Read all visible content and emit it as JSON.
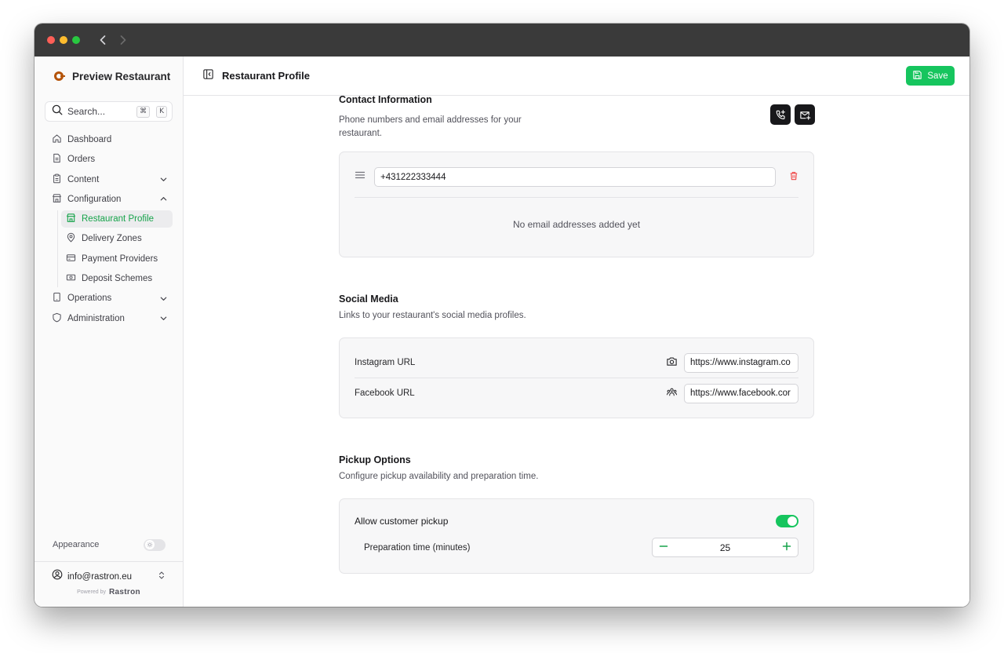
{
  "window": {
    "traffic_lights": [
      "close",
      "minimize",
      "zoom"
    ],
    "nav": {
      "back_icon": "chevron-left-icon",
      "forward_icon": "chevron-right-icon"
    }
  },
  "sidebar": {
    "brand": "Preview Restaurant",
    "search": {
      "placeholder": "Search...",
      "shortcut_mod": "⌘",
      "shortcut_key": "K"
    },
    "items": [
      {
        "label": "Dashboard",
        "icon": "home-icon"
      },
      {
        "label": "Orders",
        "icon": "document-icon"
      },
      {
        "label": "Content",
        "icon": "clipboard-icon",
        "expandable": true,
        "expanded": false
      },
      {
        "label": "Configuration",
        "icon": "store-icon",
        "expandable": true,
        "expanded": true,
        "children": [
          {
            "label": "Restaurant Profile",
            "icon": "store-icon",
            "active": true
          },
          {
            "label": "Delivery Zones",
            "icon": "map-pin-icon"
          },
          {
            "label": "Payment Providers",
            "icon": "credit-card-icon"
          },
          {
            "label": "Deposit Schemes",
            "icon": "banknote-icon"
          }
        ]
      },
      {
        "label": "Operations",
        "icon": "tablet-icon",
        "expandable": true,
        "expanded": false
      },
      {
        "label": "Administration",
        "icon": "shield-icon",
        "expandable": true,
        "expanded": false
      }
    ],
    "appearance": {
      "label": "Appearance",
      "dark_mode": false
    },
    "account": {
      "email": "info@rastron.eu"
    },
    "powered_by": {
      "label": "Powered by",
      "brand": "Rastron"
    }
  },
  "header": {
    "title": "Restaurant Profile",
    "save_label": "Save",
    "accent": "#16c55e"
  },
  "contact": {
    "title": "Contact Information",
    "description": "Phone numbers and email addresses for your restaurant.",
    "phones": [
      "+431222333444"
    ],
    "emails_empty": "No email addresses added yet"
  },
  "social": {
    "title": "Social Media",
    "description": "Links to your restaurant's social media profiles.",
    "instagram": {
      "label": "Instagram URL",
      "value": "https://www.instagram.co"
    },
    "facebook": {
      "label": "Facebook URL",
      "value": "https://www.facebook.cor"
    }
  },
  "pickup": {
    "title": "Pickup Options",
    "description": "Configure pickup availability and preparation time.",
    "allow_label": "Allow customer pickup",
    "allow_enabled": true,
    "prep_label": "Preparation time (minutes)",
    "prep_value": "25"
  }
}
